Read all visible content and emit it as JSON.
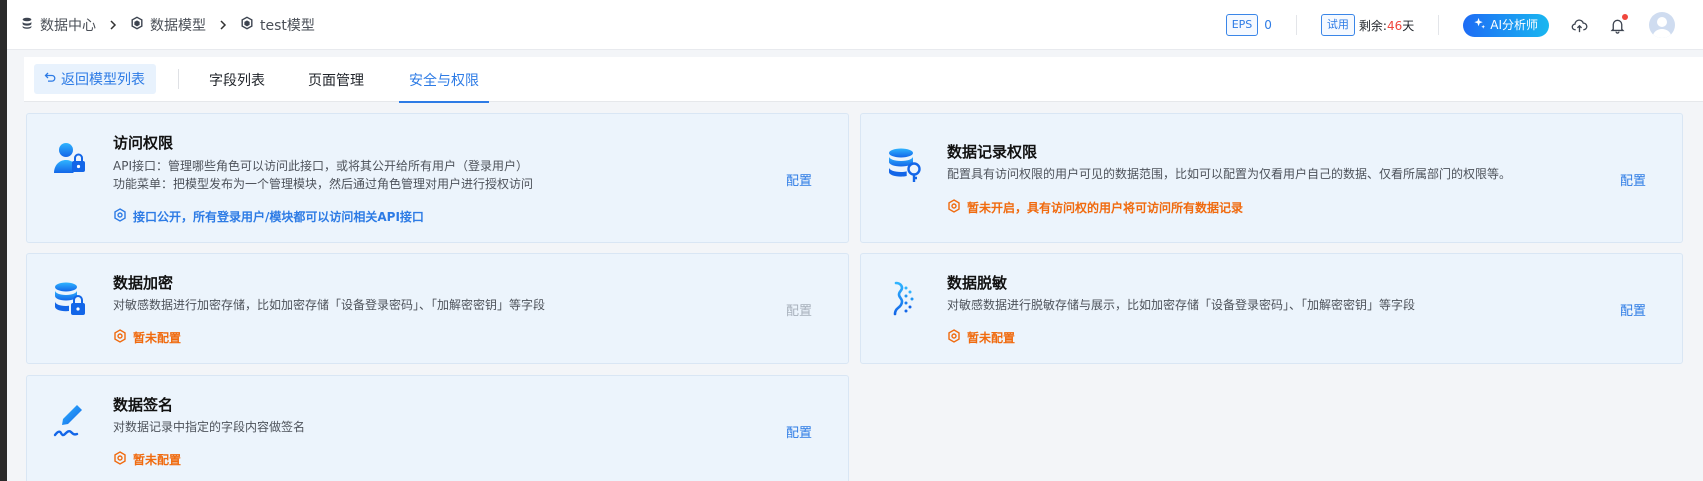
{
  "breadcrumb": [
    {
      "label": "数据中心",
      "icon": "database-icon"
    },
    {
      "label": "数据模型",
      "icon": "cube-icon"
    },
    {
      "label": "test模型",
      "icon": "cube-icon"
    }
  ],
  "header": {
    "eps_label": "EPS",
    "eps_value": "0",
    "trial_label": "试用",
    "remaining_prefix": "剩余:",
    "remaining_days": "46",
    "remaining_suffix": "天",
    "ai_button": "AI分析师",
    "notification_dot": true
  },
  "tabs": {
    "back_label": "返回模型列表",
    "items": [
      {
        "label": "字段列表",
        "active": false
      },
      {
        "label": "页面管理",
        "active": false
      },
      {
        "label": "安全与权限",
        "active": true
      }
    ]
  },
  "cards": [
    {
      "title": "访问权限",
      "desc_lines": [
        "API接口：管理哪些角色可以访问此接口，或将其公开给所有用户（登录用户）",
        "功能菜单：把模型发布为一个管理模块，然后通过角色管理对用户进行授权访问"
      ],
      "status": "接口公开，所有登录用户/模块都可以访问相关API接口",
      "status_color": "#2d7be5",
      "config": "配置",
      "config_enabled": true
    },
    {
      "title": "数据记录权限",
      "desc_lines": [
        "配置具有访问权限的用户可见的数据范围，比如可以配置为仅看用户自己的数据、仅看所属部门的权限等。"
      ],
      "status": "暂未开启，具有访问权的用户将可访问所有数据记录",
      "status_color": "#f06a0e",
      "config": "配置",
      "config_enabled": true
    },
    {
      "title": "数据加密",
      "desc_lines": [
        "对敏感数据进行加密存储，比如加密存储「设备登录密码」、「加解密密钥」等字段"
      ],
      "status": "暂未配置",
      "status_color": "#f06a0e",
      "config": "配置",
      "config_enabled": false
    },
    {
      "title": "数据脱敏",
      "desc_lines": [
        "对敏感数据进行脱敏存储与展示，比如加密存储「设备登录密码」、「加解密密钥」等字段"
      ],
      "status": "暂未配置",
      "status_color": "#f06a0e",
      "config": "配置",
      "config_enabled": true
    },
    {
      "title": "数据签名",
      "desc_lines": [
        "对数据记录中指定的字段内容做签名"
      ],
      "status": "暂未配置",
      "status_color": "#f06a0e",
      "config": "配置",
      "config_enabled": true
    }
  ]
}
